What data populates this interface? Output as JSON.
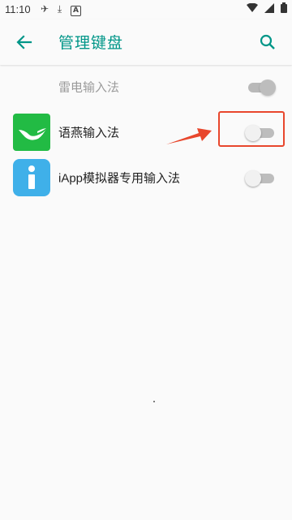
{
  "status_bar": {
    "time": "11:10",
    "left_icons": [
      "airplane-icon",
      "download-icon",
      "a-icon"
    ],
    "right_icons": [
      "wifi-icon",
      "signal-icon",
      "battery-icon"
    ]
  },
  "app_bar": {
    "title": "管理键盘",
    "accent_color": "#009688"
  },
  "keyboards": [
    {
      "label": "雷电输入法",
      "enabled": true,
      "disabled": true,
      "icon": "none"
    },
    {
      "label": "语燕输入法",
      "enabled": false,
      "disabled": false,
      "icon": "yuyan-swallow-icon",
      "icon_color": "#22bb44"
    },
    {
      "label": "iApp模拟器专用输入法",
      "enabled": false,
      "disabled": false,
      "icon": "iapp-i-icon",
      "icon_color": "#3fb0e9"
    }
  ],
  "annotation": {
    "color": "#e8472d"
  }
}
